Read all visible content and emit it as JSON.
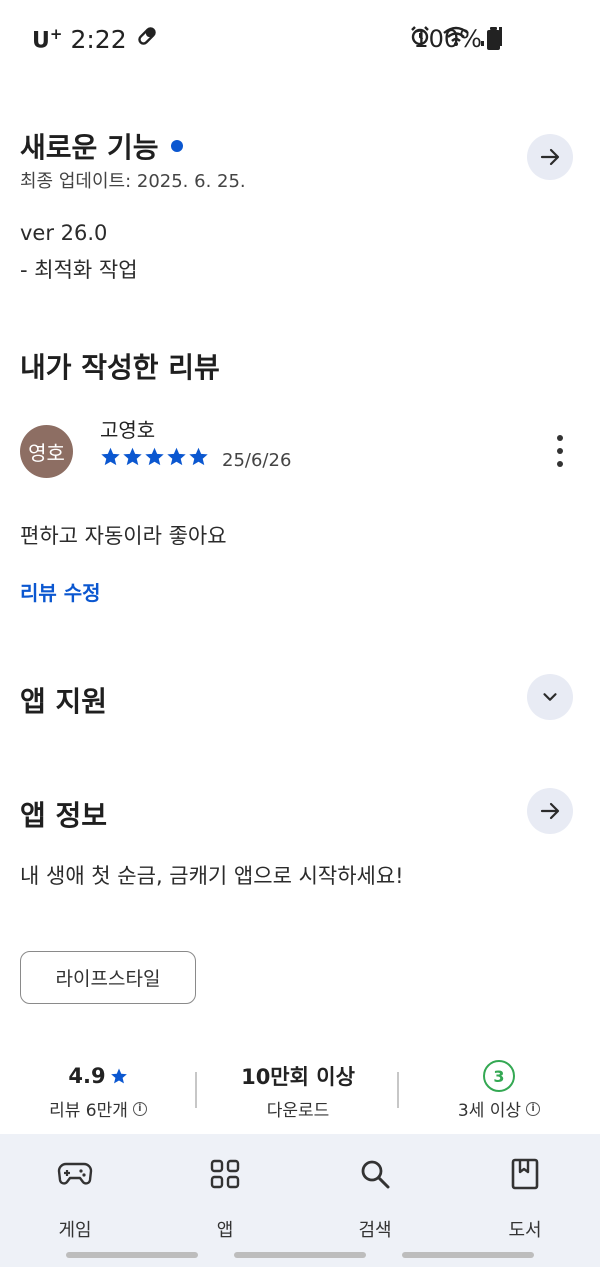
{
  "status_bar": {
    "carrier": "U",
    "carrier_plus": "+",
    "time": "2:22",
    "battery": "100%",
    "icons": [
      "pill-icon",
      "alarm-icon",
      "wifi-icon",
      "signal-icon",
      "battery-icon"
    ]
  },
  "whats_new": {
    "title": "새로운 기능",
    "last_updated": "최종 업데이트: 2025. 6. 25.",
    "version": "ver 26.0",
    "note": "- 최적화 작업"
  },
  "my_review": {
    "title": "내가 작성한 리뷰",
    "avatar_text": "영호",
    "avatar_color": "#8d6e63",
    "reviewer": "고영호",
    "rating": 5,
    "date": "25/6/26",
    "body": "편하고 자동이라 좋아요",
    "edit_link": "리뷰 수정"
  },
  "app_support": {
    "title": "앱 지원"
  },
  "app_info": {
    "title": "앱 정보",
    "description": "내 생애 첫 순금, 금캐기 앱으로 시작하세요!",
    "category_chip": "라이프스타일"
  },
  "stats": {
    "rating_value": "4.9",
    "rating_label": "리뷰 6만개",
    "downloads_value": "10만회 이상",
    "downloads_label": "다운로드",
    "age_badge": "3",
    "age_label": "3세 이상"
  },
  "bottom_nav": {
    "items": [
      {
        "label": "게임",
        "icon": "gamepad-icon"
      },
      {
        "label": "앱",
        "icon": "apps-grid-icon"
      },
      {
        "label": "검색",
        "icon": "search-icon"
      },
      {
        "label": "도서",
        "icon": "book-icon"
      }
    ]
  },
  "colors": {
    "accent": "#0b57d0",
    "button_bg": "#e8ebf4",
    "nav_bg": "#eef1f7",
    "age_badge": "#34a853"
  }
}
